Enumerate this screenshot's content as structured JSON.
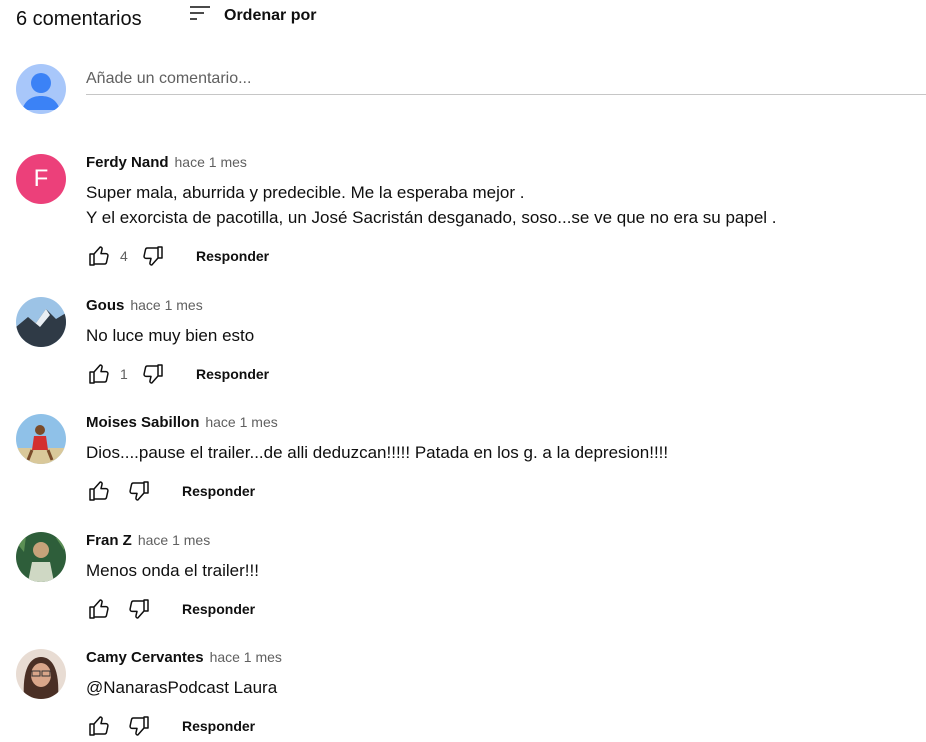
{
  "header": {
    "count_label": "6 comentarios",
    "sort_label": "Ordenar por"
  },
  "add_comment": {
    "placeholder": "Añade un comentario..."
  },
  "colors": {
    "letter_avatar": "#ec407a",
    "default_avatar": "#3b82f6",
    "secondary_text": "#606060"
  },
  "comments": [
    {
      "author": "Ferdy Nand",
      "time": "hace 1 mes",
      "text": "Super mala, aburrida y predecible. Me la esperaba mejor .\nY el exorcista de pacotilla, un José Sacristán desganado, soso...se ve que no era su papel .",
      "likes": "4",
      "reply_label": "Responder",
      "avatar_letter": "F"
    },
    {
      "author": "Gous",
      "time": "hace 1 mes",
      "text": "No luce muy bien esto",
      "likes": "1",
      "reply_label": "Responder"
    },
    {
      "author": "Moises Sabillon",
      "time": "hace 1 mes",
      "text": "Dios....pause el trailer...de alli deduzcan!!!!! Patada en los g. a la depresion!!!!",
      "likes": "",
      "reply_label": "Responder"
    },
    {
      "author": "Fran Z",
      "time": "hace 1 mes",
      "text": "Menos onda el trailer!!!",
      "likes": "",
      "reply_label": "Responder"
    },
    {
      "author": "Camy Cervantes",
      "time": "hace 1 mes",
      "text": "@NanarasPodcast Laura",
      "likes": "",
      "reply_label": "Responder"
    }
  ]
}
